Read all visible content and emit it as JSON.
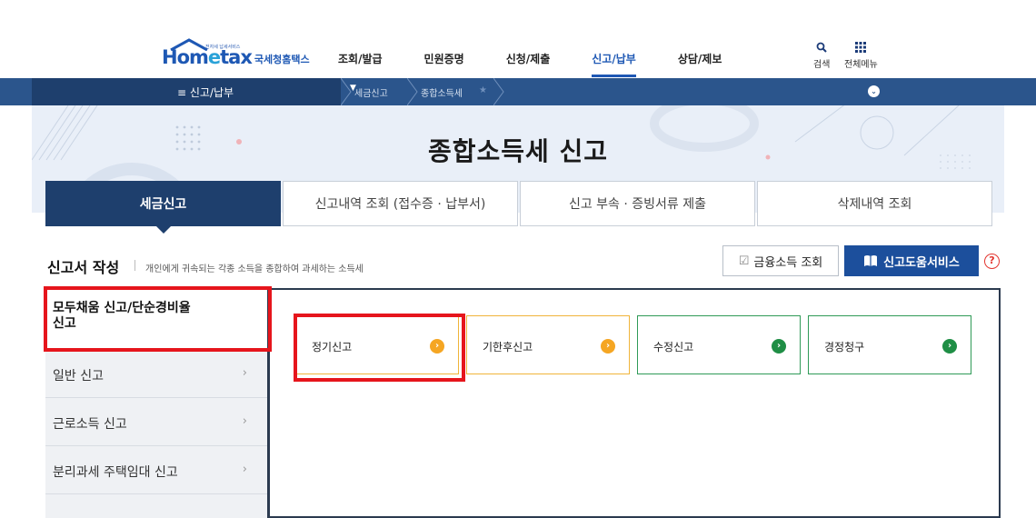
{
  "header": {
    "logo_small": "전자세 납세서비스",
    "logo_main_prefix": "Hom",
    "logo_main_e": "e",
    "logo_main_suffix": "tax",
    "logo_sub": "국세청홈택스",
    "nav": [
      "조회/발급",
      "민원증명",
      "신청/제출",
      "신고/납부",
      "상담/제보"
    ],
    "active_nav": "신고/납부",
    "search_label": "검색",
    "menu_label": "전체메뉴"
  },
  "location": {
    "menu_label": "≡ 신고/납부",
    "crumbs": [
      "세금신고",
      "종합소득세"
    ]
  },
  "hero": {
    "title": "종합소득세 신고"
  },
  "tabs": [
    {
      "label": "세금신고",
      "active": true
    },
    {
      "label": "신고내역 조회 (접수증 · 납부서)",
      "active": false
    },
    {
      "label": "신고 부속 · 증빙서류 제출",
      "active": false
    },
    {
      "label": "삭제내역 조회",
      "active": false
    }
  ],
  "section": {
    "title": "신고서 작성",
    "desc": "개인에게 귀속되는 각종 소득을 종합하여 과세하는 소득세",
    "finance_button": "금융소득 조회",
    "help_button": "신고도움서비스",
    "help_icon": "?"
  },
  "leftmenu": [
    {
      "label": "모두채움 신고/단순경비율 신고",
      "line1": "모두채움 신고/단순경비율",
      "line2": "신고",
      "active": true
    },
    {
      "label": "일반 신고",
      "active": false
    },
    {
      "label": "근로소득 신고",
      "active": false
    },
    {
      "label": "분리과세 주택임대 신고",
      "active": false
    }
  ],
  "cards": [
    {
      "label": "정기신고",
      "style": "orange"
    },
    {
      "label": "기한후신고",
      "style": "orange"
    },
    {
      "label": "수정신고",
      "style": "green"
    },
    {
      "label": "경정청구",
      "style": "green"
    }
  ],
  "colors": {
    "primary_navy": "#1e3f6d",
    "location_bar": "#2b558c",
    "highlight_red": "#e6151c",
    "orange": "#f5a623",
    "green": "#1f8e45",
    "help_button": "#1c4f9c"
  }
}
